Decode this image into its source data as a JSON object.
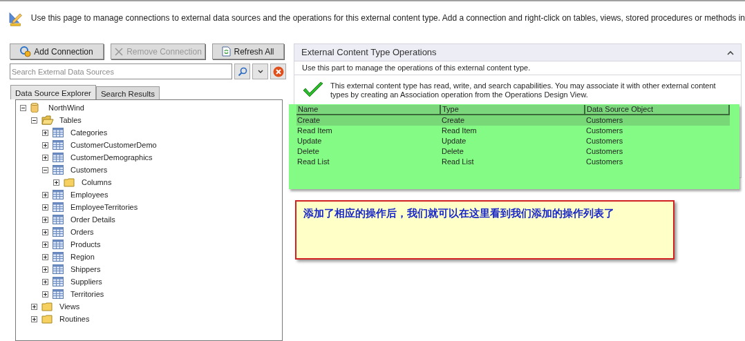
{
  "header": {
    "text": "Use this page to manage connections to external data sources and the operations for this external content type. Add a connection and right-click on tables, views, stored procedures or methods in"
  },
  "toolbar": [
    {
      "kind": "add",
      "label": "Add Connection",
      "disabled": false
    },
    {
      "kind": "remove",
      "label": "Remove Connection",
      "disabled": true
    },
    {
      "kind": "refresh",
      "label": "Refresh All",
      "disabled": false
    }
  ],
  "search": {
    "placeholder": "Search External Data Sources"
  },
  "tabs": [
    {
      "label": "Data Source Explorer",
      "selected": true
    },
    {
      "label": "Search Results",
      "selected": false
    }
  ],
  "tree": [
    {
      "label": "NorthWind",
      "kind": "database",
      "expanded": true,
      "children": [
        {
          "label": "Tables",
          "kind": "folder-open",
          "expanded": true,
          "children": [
            {
              "label": "Categories",
              "kind": "table",
              "expanded": false
            },
            {
              "label": "CustomerCustomerDemo",
              "kind": "table",
              "expanded": false
            },
            {
              "label": "CustomerDemographics",
              "kind": "table",
              "expanded": false
            },
            {
              "label": "Customers",
              "kind": "table",
              "expanded": true,
              "children": [
                {
                  "label": "Columns",
                  "kind": "folder",
                  "expanded": false
                }
              ]
            },
            {
              "label": "Employees",
              "kind": "table",
              "expanded": false
            },
            {
              "label": "EmployeeTerritories",
              "kind": "table",
              "expanded": false
            },
            {
              "label": "Order Details",
              "kind": "table",
              "expanded": false
            },
            {
              "label": "Orders",
              "kind": "table",
              "expanded": false
            },
            {
              "label": "Products",
              "kind": "table",
              "expanded": false
            },
            {
              "label": "Region",
              "kind": "table",
              "expanded": false
            },
            {
              "label": "Shippers",
              "kind": "table",
              "expanded": false
            },
            {
              "label": "Suppliers",
              "kind": "table",
              "expanded": false
            },
            {
              "label": "Territories",
              "kind": "table",
              "expanded": false
            }
          ]
        },
        {
          "label": "Views",
          "kind": "folder",
          "expanded": false
        },
        {
          "label": "Routines",
          "kind": "folder",
          "expanded": false
        }
      ]
    }
  ],
  "operations": {
    "title": "External Content Type Operations",
    "expanded": true,
    "description": "Use this part to manage the operations of this external content type.",
    "status": "This external content type has read, write, and search capabilities. You may associate it with other external content types by creating an Association operation from the Operations Design View.",
    "columns": [
      "Name",
      "Type",
      "Data Source Object"
    ],
    "rows": [
      {
        "cells": [
          "Create",
          "Create",
          "Customers"
        ],
        "selected": true
      },
      {
        "cells": [
          "Read Item",
          "Read Item",
          "Customers"
        ],
        "selected": false
      },
      {
        "cells": [
          "Update",
          "Update",
          "Customers"
        ],
        "selected": false
      },
      {
        "cells": [
          "Delete",
          "Delete",
          "Customers"
        ],
        "selected": false
      },
      {
        "cells": [
          "Read List",
          "Read List",
          "Customers"
        ],
        "selected": false
      }
    ]
  },
  "callout": {
    "text": "添加了相应的操作后，我们就可以在这里看到我们添加的操作列表了"
  }
}
